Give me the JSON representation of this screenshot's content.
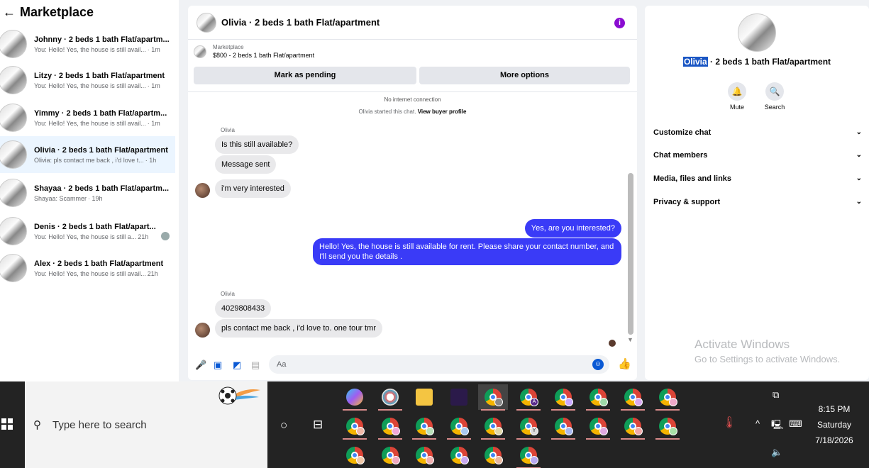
{
  "sidebar": {
    "title": "Marketplace",
    "conversations": [
      {
        "name": "Johnny · 2 beds 1 bath Flat/apartm...",
        "message": "You: Hello! Yes, the house is still avail...",
        "time": "· 1m"
      },
      {
        "name": "Litzy · 2 beds 1 bath Flat/apartment",
        "message": "You: Hello! Yes, the house is still avail...",
        "time": "· 1m"
      },
      {
        "name": "Yimmy · 2 beds 1 bath Flat/apartm...",
        "message": "You: Hello! Yes, the house is still avail...",
        "time": "· 1m"
      },
      {
        "name": "Olivia · 2 beds 1 bath Flat/apartment",
        "message": "Olivia: pls contact me back , i'd love t...",
        "time": "· 1h"
      },
      {
        "name": "Shayaa · 2 beds 1 bath Flat/apartm...",
        "message": "Shayaa: Scammer",
        "time": "· 19h"
      },
      {
        "name": "Denis · 2 beds 1 bath Flat/apart...",
        "message": "You: Hello! Yes, the house is still a...",
        "time": "21h"
      },
      {
        "name": "Alex · 2 beds 1 bath Flat/apartment",
        "message": "You: Hello! Yes, the house is still avail...",
        "time": "21h"
      }
    ]
  },
  "chat": {
    "title": "Olivia · 2 beds 1 bath Flat/apartment",
    "info_icon": "i",
    "listing_category": "Marketplace",
    "listing_price": "$800 - 2 beds 1 bath Flat/apartment",
    "mark_pending": "Mark as pending",
    "more_options": "More options",
    "status": "No internet connection",
    "started_text": "Olivia started this chat.",
    "view_profile": "View buyer profile",
    "sender": "Olivia",
    "messages": {
      "m1": "Is this still available?",
      "m2": "Message sent",
      "m3": "i'm very interested",
      "m4": "Yes, are you interested?",
      "m5": "Hello! Yes, the house is still available for rent. Please share your contact number, and I'll send you the details .",
      "m6": "4029808433",
      "m7": "pls contact me back , i'd love to. one tour tmr"
    },
    "input_placeholder": "Aa"
  },
  "details": {
    "name_highlight": "Olivia",
    "name_rest": " · 2 beds 1 bath Flat/apartment",
    "mute": "Mute",
    "search": "Search",
    "sections": [
      "Customize chat",
      "Chat members",
      "Media, files and links",
      "Privacy & support"
    ],
    "watermark_title": "Activate Windows",
    "watermark_sub": "Go to Settings to activate Windows."
  },
  "taskbar": {
    "search_placeholder": "Type here to search",
    "time": "8:15 PM",
    "day": "Saturday",
    "date": "7/18/2026",
    "badge_a": "A",
    "badge_y": "Y"
  },
  "colors": {
    "accent": "#3a3bf7",
    "info": "#8a0cd1",
    "highlight": "#1a56c4",
    "active_conv": "#ebf5ff"
  }
}
